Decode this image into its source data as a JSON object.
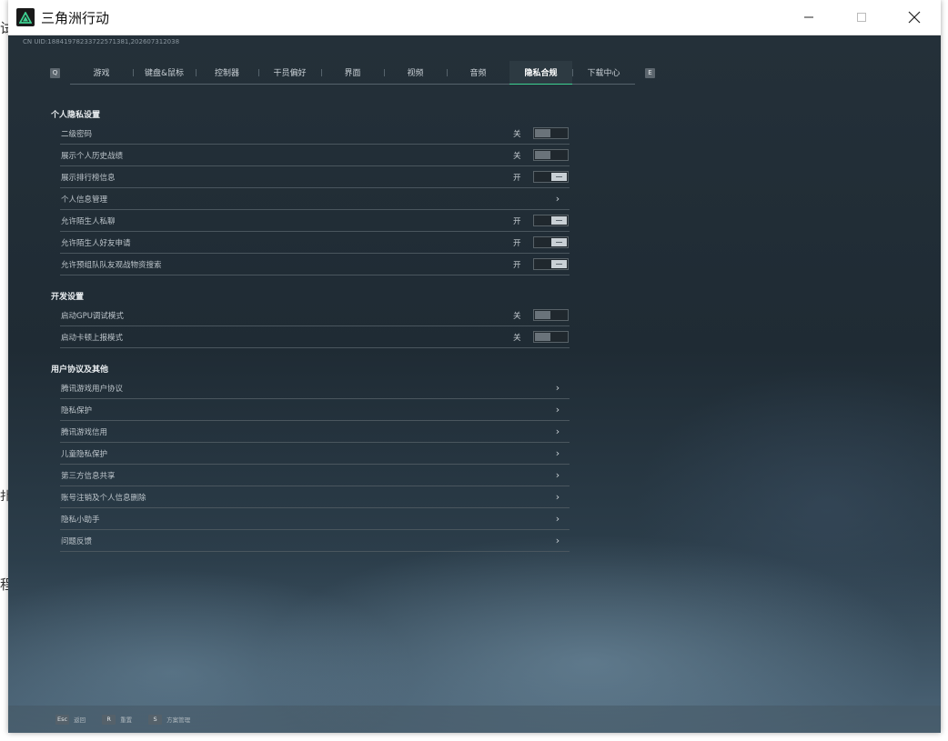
{
  "window": {
    "title": "三角洲行动"
  },
  "uid": "CN UID:18841978233722571381,202607312038",
  "nav": {
    "prev_key": "Q",
    "next_key": "E"
  },
  "tabs": [
    {
      "label": "游戏",
      "active": false
    },
    {
      "label": "键盘&鼠标",
      "active": false
    },
    {
      "label": "控制器",
      "active": false
    },
    {
      "label": "干员偏好",
      "active": false
    },
    {
      "label": "界面",
      "active": false
    },
    {
      "label": "视频",
      "active": false
    },
    {
      "label": "音频",
      "active": false
    },
    {
      "label": "隐私合规",
      "active": true
    },
    {
      "label": "下载中心",
      "active": false
    }
  ],
  "state_labels": {
    "on": "开",
    "off": "关"
  },
  "sections": [
    {
      "title": "个人隐私设置",
      "rows": [
        {
          "label": "二级密码",
          "type": "toggle",
          "value": "off"
        },
        {
          "label": "展示个人历史战绩",
          "type": "toggle",
          "value": "off"
        },
        {
          "label": "展示排行榜信息",
          "type": "toggle",
          "value": "on"
        },
        {
          "label": "个人信息管理",
          "type": "link"
        },
        {
          "label": "允许陌生人私聊",
          "type": "toggle",
          "value": "on"
        },
        {
          "label": "允许陌生人好友申请",
          "type": "toggle",
          "value": "on"
        },
        {
          "label": "允许预组队队友观战物资搜索",
          "type": "toggle",
          "value": "on"
        }
      ]
    },
    {
      "title": "开发设置",
      "rows": [
        {
          "label": "启动GPU调试模式",
          "type": "toggle",
          "value": "off"
        },
        {
          "label": "启动卡顿上报模式",
          "type": "toggle",
          "value": "off"
        }
      ]
    },
    {
      "title": "用户协议及其他",
      "rows": [
        {
          "label": "腾讯游戏用户协议",
          "type": "link"
        },
        {
          "label": "隐私保护",
          "type": "link"
        },
        {
          "label": "腾讯游戏信用",
          "type": "link"
        },
        {
          "label": "儿童隐私保护",
          "type": "link"
        },
        {
          "label": "第三方信息共享",
          "type": "link"
        },
        {
          "label": "账号注销及个人信息删除",
          "type": "link"
        },
        {
          "label": "隐私小助手",
          "type": "link"
        },
        {
          "label": "问题反馈",
          "type": "link"
        }
      ]
    }
  ],
  "footer": [
    {
      "key": "Esc",
      "label": "返回"
    },
    {
      "key": "R",
      "label": "重置"
    },
    {
      "key": "S",
      "label": "方案管理"
    }
  ]
}
